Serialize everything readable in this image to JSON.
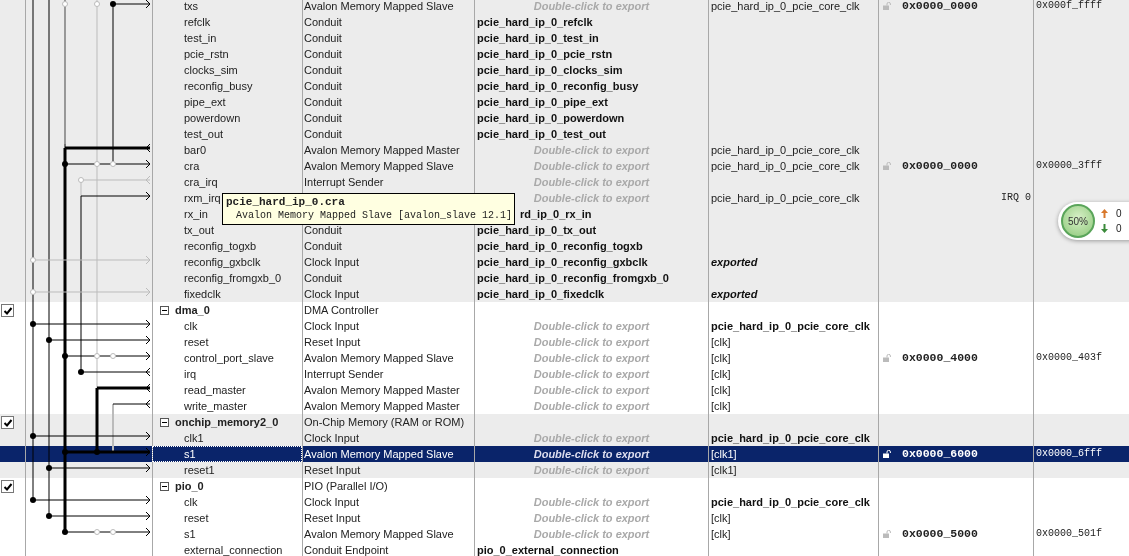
{
  "modules": [
    {
      "shaded": true,
      "ports": [
        {
          "name": "txs",
          "description": "Avalon Memory Mapped Slave",
          "export": "Double-click to export",
          "kind": "hint",
          "clock": "pcie_hard_ip_0_pcie_core_clk",
          "clock_bold": false,
          "base": "0x0000_0000",
          "end": "0x000f_ffff",
          "selected": false
        },
        {
          "name": "refclk",
          "description": "Conduit",
          "export": "pcie_hard_ip_0_refclk",
          "kind": "name",
          "selected": false
        },
        {
          "name": "test_in",
          "description": "Conduit",
          "export": "pcie_hard_ip_0_test_in",
          "kind": "name",
          "selected": false
        },
        {
          "name": "pcie_rstn",
          "description": "Conduit",
          "export": "pcie_hard_ip_0_pcie_rstn",
          "kind": "name",
          "selected": false
        },
        {
          "name": "clocks_sim",
          "description": "Conduit",
          "export": "pcie_hard_ip_0_clocks_sim",
          "kind": "name",
          "selected": false
        },
        {
          "name": "reconfig_busy",
          "description": "Conduit",
          "export": "pcie_hard_ip_0_reconfig_busy",
          "kind": "name",
          "selected": false
        },
        {
          "name": "pipe_ext",
          "description": "Conduit",
          "export": "pcie_hard_ip_0_pipe_ext",
          "kind": "name",
          "selected": false
        },
        {
          "name": "powerdown",
          "description": "Conduit",
          "export": "pcie_hard_ip_0_powerdown",
          "kind": "name",
          "selected": false
        },
        {
          "name": "test_out",
          "description": "Conduit",
          "export": "pcie_hard_ip_0_test_out",
          "kind": "name",
          "selected": false
        },
        {
          "name": "bar0",
          "description": "Avalon Memory Mapped Master",
          "export": "Double-click to export",
          "kind": "hint",
          "clock": "pcie_hard_ip_0_pcie_core_clk",
          "clock_bold": false,
          "selected": false
        },
        {
          "name": "cra",
          "description": "Avalon Memory Mapped Slave",
          "export": "Double-click to export",
          "kind": "hint",
          "clock": "pcie_hard_ip_0_pcie_core_clk",
          "clock_bold": false,
          "base": "0x0000_0000",
          "end": "0x0000_3fff",
          "selected": false
        },
        {
          "name": "cra_irq",
          "description": "Interrupt Sender",
          "export": "Double-click to export",
          "kind": "hint",
          "selected": false
        },
        {
          "name": "rxm_irq",
          "export": "Double-click to export",
          "kind": "hint",
          "clock": "pcie_hard_ip_0_pcie_core_clk",
          "clock_bold": false,
          "irq": "IRQ 0",
          "selected": false
        },
        {
          "name": "rx_in",
          "export": "rd_ip_0_rx_in",
          "kind": "cut",
          "selected": false
        },
        {
          "name": "tx_out",
          "description": "Conduit",
          "export": "pcie_hard_ip_0_tx_out",
          "kind": "name",
          "selected": false
        },
        {
          "name": "reconfig_togxb",
          "description": "Conduit",
          "export": "pcie_hard_ip_0_reconfig_togxb",
          "kind": "name",
          "selected": false
        },
        {
          "name": "reconfig_gxbclk",
          "description": "Clock Input",
          "export": "pcie_hard_ip_0_reconfig_gxbclk",
          "kind": "name",
          "clock": "exported",
          "clock_bold": true,
          "selected": false
        },
        {
          "name": "reconfig_fromgxb_0",
          "description": "Conduit",
          "export": "pcie_hard_ip_0_reconfig_fromgxb_0",
          "kind": "name",
          "selected": false
        },
        {
          "name": "fixedclk",
          "description": "Clock Input",
          "export": "pcie_hard_ip_0_fixedclk",
          "kind": "name",
          "clock": "exported",
          "clock_bold": true,
          "selected": false
        }
      ]
    },
    {
      "name": "dma_0",
      "description": "DMA Controller",
      "checked": true,
      "expanded": true,
      "shaded": false,
      "ports": [
        {
          "name": "clk",
          "description": "Clock Input",
          "export": "Double-click to export",
          "kind": "hint",
          "clock": "pcie_hard_ip_0_pcie_core_clk",
          "clock_bold": true,
          "selected": false
        },
        {
          "name": "reset",
          "description": "Reset Input",
          "export": "Double-click to export",
          "kind": "hint",
          "clock": "[clk]",
          "clock_bold": false,
          "selected": false
        },
        {
          "name": "control_port_slave",
          "description": "Avalon Memory Mapped Slave",
          "export": "Double-click to export",
          "kind": "hint",
          "clock": "[clk]",
          "clock_bold": false,
          "base": "0x0000_4000",
          "end": "0x0000_403f",
          "selected": false
        },
        {
          "name": "irq",
          "description": "Interrupt Sender",
          "export": "Double-click to export",
          "kind": "hint",
          "clock": "[clk]",
          "clock_bold": false,
          "selected": false
        },
        {
          "name": "read_master",
          "description": "Avalon Memory Mapped Master",
          "export": "Double-click to export",
          "kind": "hint",
          "clock": "[clk]",
          "clock_bold": false,
          "selected": false
        },
        {
          "name": "write_master",
          "description": "Avalon Memory Mapped Master",
          "export": "Double-click to export",
          "kind": "hint",
          "clock": "[clk]",
          "clock_bold": false,
          "selected": false
        }
      ]
    },
    {
      "name": "onchip_memory2_0",
      "description": "On-Chip Memory (RAM or ROM)",
      "checked": true,
      "expanded": true,
      "shaded": true,
      "ports": [
        {
          "name": "clk1",
          "description": "Clock Input",
          "export": "Double-click to export",
          "kind": "hint",
          "clock": "pcie_hard_ip_0_pcie_core_clk",
          "clock_bold": true,
          "selected": false
        },
        {
          "name": "s1",
          "description": "Avalon Memory Mapped Slave",
          "export": "Double-click to export",
          "kind": "hint",
          "clock": "[clk1]",
          "clock_bold": false,
          "base": "0x0000_6000",
          "end": "0x0000_6fff",
          "selected": true
        },
        {
          "name": "reset1",
          "description": "Reset Input",
          "export": "Double-click to export",
          "kind": "hint",
          "clock": "[clk1]",
          "clock_bold": false,
          "selected": false
        }
      ]
    },
    {
      "name": "pio_0",
      "description": "PIO (Parallel I/O)",
      "checked": true,
      "expanded": true,
      "shaded": false,
      "ports": [
        {
          "name": "clk",
          "description": "Clock Input",
          "export": "Double-click to export",
          "kind": "hint",
          "clock": "pcie_hard_ip_0_pcie_core_clk",
          "clock_bold": true,
          "selected": false
        },
        {
          "name": "reset",
          "description": "Reset Input",
          "export": "Double-click to export",
          "kind": "hint",
          "clock": "[clk]",
          "clock_bold": false,
          "selected": false
        },
        {
          "name": "s1",
          "description": "Avalon Memory Mapped Slave",
          "export": "Double-click to export",
          "kind": "hint",
          "clock": "[clk]",
          "clock_bold": false,
          "base": "0x0000_5000",
          "end": "0x0000_501f",
          "selected": false
        },
        {
          "name": "external_connection",
          "description": "Conduit Endpoint",
          "export": "pio_0_external_connection",
          "kind": "name",
          "selected": false
        }
      ]
    }
  ],
  "tooltip": {
    "title": "pcie_hard_ip_0.cra",
    "text": "Avalon Memory Mapped Slave [avalon_slave 12.1]"
  },
  "speed_widget": {
    "percent": "50%",
    "up": "0",
    "down": "0"
  }
}
